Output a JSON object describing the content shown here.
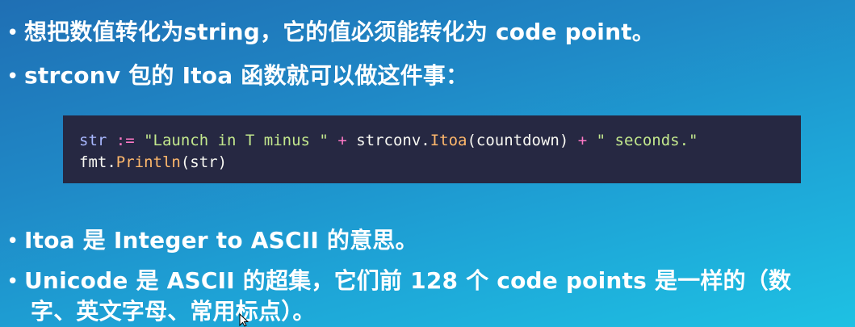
{
  "bullets": [
    {
      "text": "想把数值转化为string，它的值必须能转化为 code point。"
    },
    {
      "text": "strconv 包的 Itoa 函数就可以做这件事："
    },
    {
      "text": "Itoa 是 Integer to ASCII 的意思。"
    },
    {
      "line1": "Unicode 是 ASCII 的超集，它们前 128 个 code points 是一样的（数",
      "line2": "字、英文字母、常用标点）。"
    }
  ],
  "bullet_marker": "•",
  "code": {
    "line1": {
      "t1": "str",
      "t2": " := ",
      "t3": "\"Launch in T minus \"",
      "t4": " + ",
      "t5": "strconv.",
      "t6": "Itoa",
      "t7": "(countdown)",
      "t8": " + ",
      "t9": "\" seconds.\""
    },
    "line2": {
      "t1": "fmt.",
      "t2": "Println",
      "t3": "(str)"
    }
  },
  "colors": {
    "code_bg": "#262842",
    "identifier": "#a9b8ff",
    "operator": "#ff79c6",
    "string": "#c3e88d",
    "function": "#ffb86c",
    "text": "#ffffff"
  }
}
